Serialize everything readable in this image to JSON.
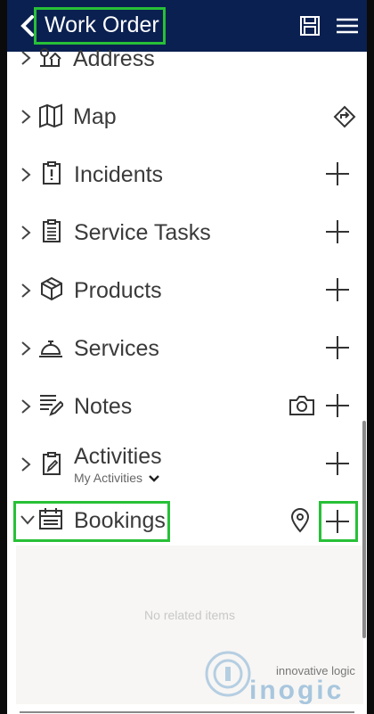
{
  "header": {
    "back_icon": "chevron-left-icon",
    "title": "Work Order",
    "save_icon": "save-icon",
    "menu_icon": "hamburger-menu-icon"
  },
  "sections": {
    "address": {
      "label": "Address",
      "icon": "address-icon"
    },
    "map": {
      "label": "Map",
      "icon": "map-icon",
      "action_icon": "directions-icon"
    },
    "incidents": {
      "label": "Incidents",
      "icon": "incident-icon"
    },
    "service_tasks": {
      "label": "Service Tasks",
      "icon": "clipboard-icon"
    },
    "products": {
      "label": "Products",
      "icon": "box-icon"
    },
    "services": {
      "label": "Services",
      "icon": "service-bell-icon"
    },
    "notes": {
      "label": "Notes",
      "icon": "notes-icon",
      "action_icon": "camera-icon"
    },
    "activities": {
      "label": "Activities",
      "icon": "activity-icon",
      "filter": "My Activities"
    },
    "bookings": {
      "label": "Bookings",
      "icon": "calendar-icon",
      "action_icon": "location-pin-icon",
      "empty_text": "No related items"
    }
  },
  "watermark": {
    "tagline": "innovative logic",
    "brand": "inogic"
  },
  "colors": {
    "header": "#0a2050",
    "highlight": "#27c037",
    "text": "#3a3a3a"
  }
}
